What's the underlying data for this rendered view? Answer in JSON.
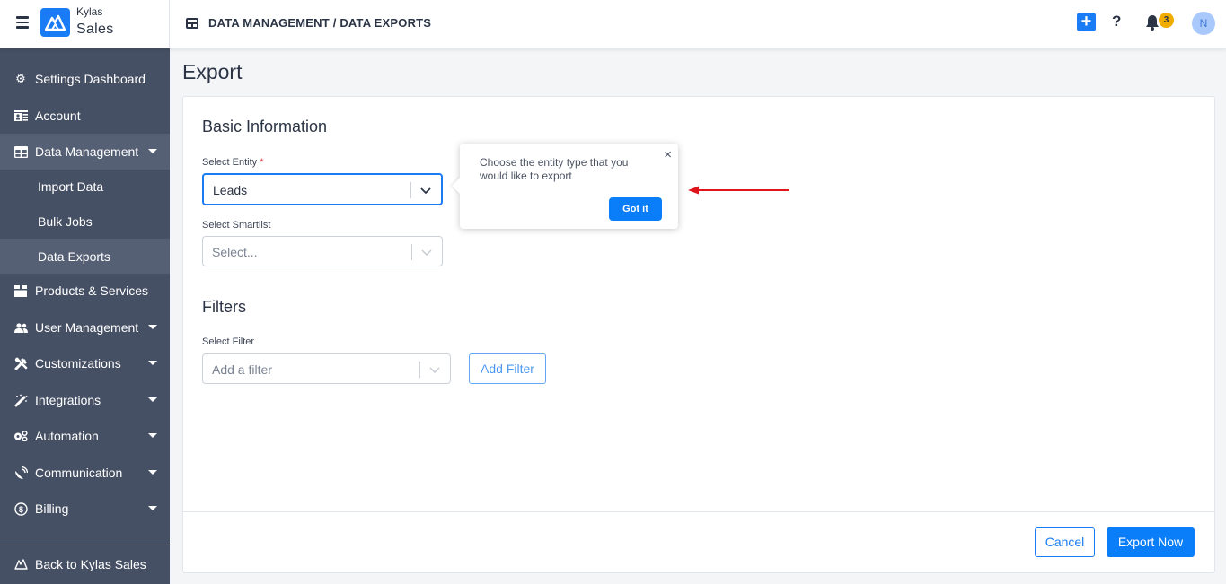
{
  "brand": {
    "small": "Kylas",
    "big": "Sales",
    "logo_color": "#1a7cf5"
  },
  "header": {
    "breadcrumb": "DATA MANAGEMENT / DATA EXPORTS",
    "plus_icon": "+",
    "help_icon": "?",
    "notification_count": "3",
    "avatar_initial": "N"
  },
  "sidebar": {
    "items": [
      {
        "label": "Settings Dashboard",
        "icon": "gear-icon"
      },
      {
        "label": "Account",
        "icon": "id-card-icon"
      },
      {
        "label": "Data Management",
        "icon": "table-icon",
        "expanded": true
      },
      {
        "label": "Import Data"
      },
      {
        "label": "Bulk Jobs"
      },
      {
        "label": "Data Exports",
        "active": true
      },
      {
        "label": "Products & Services",
        "icon": "box-icon"
      },
      {
        "label": "User Management",
        "icon": "users-icon"
      },
      {
        "label": "Customizations",
        "icon": "tools-icon"
      },
      {
        "label": "Integrations",
        "icon": "magic-wand-icon"
      },
      {
        "label": "Automation",
        "icon": "cogs-icon"
      },
      {
        "label": "Communication",
        "icon": "satellite-dish-icon"
      },
      {
        "label": "Billing",
        "icon": "dollar-circle-icon"
      }
    ],
    "back_label": "Back to Kylas Sales"
  },
  "main": {
    "title": "Export",
    "basic_info": {
      "heading": "Basic Information",
      "entity_label": "Select Entity",
      "required_mark": "*",
      "entity_value": "Leads",
      "smartlist_label": "Select Smartlist",
      "smartlist_placeholder": "Select..."
    },
    "filters": {
      "heading": "Filters",
      "filter_label": "Select Filter",
      "filter_placeholder": "Add a filter",
      "add_filter_label": "Add Filter"
    },
    "footer": {
      "cancel_label": "Cancel",
      "export_label": "Export Now"
    }
  },
  "tooltip": {
    "text": "Choose the entity type that you would like to export",
    "button_label": "Got it",
    "close_icon": "×"
  },
  "colors": {
    "accent": "#0a7ef8",
    "sidebar_bg": "#465064",
    "annotation_arrow": "#e0141c",
    "badge": "#f0ad00"
  }
}
